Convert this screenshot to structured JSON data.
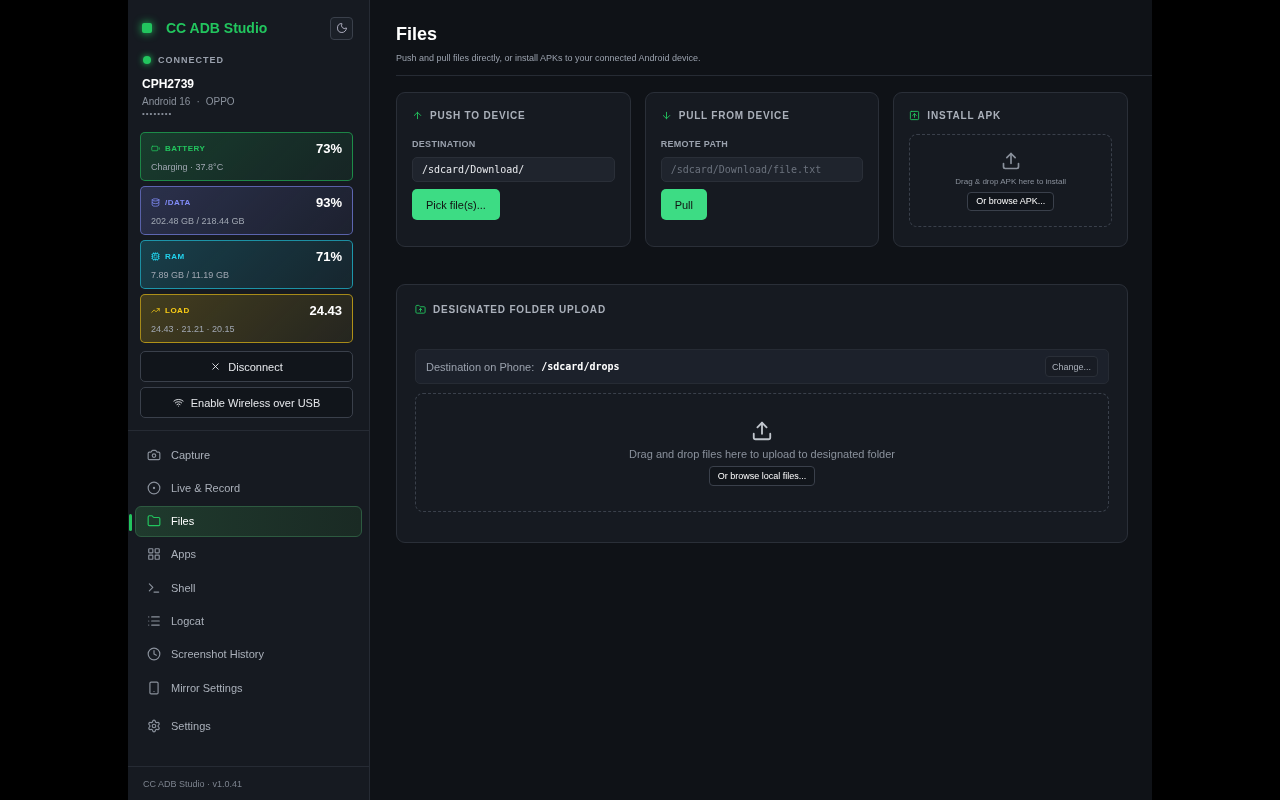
{
  "brand": {
    "name": "CC ADB Studio"
  },
  "device": {
    "status": "CONNECTED",
    "connected": true,
    "model": "CPH2739",
    "android": "Android 16",
    "maker": "OPPO",
    "separator": "·",
    "serial": "••••••••"
  },
  "stats": [
    {
      "label": "BATTERY",
      "value": "73%",
      "detail": "Charging · 37.8°C",
      "color": "#22c55e"
    },
    {
      "label": "/DATA",
      "value": "93%",
      "detail": "202.48 GB / 218.44 GB",
      "color": "#818cf8"
    },
    {
      "label": "RAM",
      "value": "71%",
      "detail": "7.89 GB / 11.19 GB",
      "color": "#22d3ee"
    },
    {
      "label": "LOAD",
      "value": "24.43",
      "detail": "24.43 · 21.21 · 20.15",
      "color": "#facc15"
    }
  ],
  "actions": [
    "Disconnect",
    "Enable Wireless over USB"
  ],
  "nav": [
    {
      "label": "Capture",
      "selected": false
    },
    {
      "label": "Live & Record",
      "selected": false
    },
    {
      "label": "Files",
      "selected": true
    },
    {
      "label": "Apps",
      "selected": false
    },
    {
      "label": "Shell",
      "selected": false
    },
    {
      "label": "Logcat",
      "selected": false
    },
    {
      "label": "Screenshot History",
      "selected": false
    },
    {
      "label": "Mirror Settings",
      "selected": false
    },
    {
      "label": "Settings",
      "selected": false
    }
  ],
  "footer": "CC ADB Studio · v1.0.41",
  "page": {
    "title": "Files",
    "subtitle": "Push and pull files directly, or install APKs to your connected Android device."
  },
  "push": {
    "title": "PUSH TO DEVICE",
    "field_label": "DESTINATION",
    "value": "/sdcard/Download/",
    "button": "Pick file(s)..."
  },
  "pull": {
    "title": "PULL FROM DEVICE",
    "field_label": "REMOTE PATH",
    "placeholder": "/sdcard/Download/file.txt",
    "button": "Pull"
  },
  "apk": {
    "title": "INSTALL APK",
    "hint": "Drag & drop APK here to install",
    "button": "Or browse APK..."
  },
  "folder": {
    "title": "DESIGNATED FOLDER UPLOAD",
    "dest_label": "Destination on Phone:",
    "dest_path": "/sdcard/drops",
    "change": "Change...",
    "hint": "Drag and drop files here to upload to designated folder",
    "button": "Or browse local files..."
  }
}
